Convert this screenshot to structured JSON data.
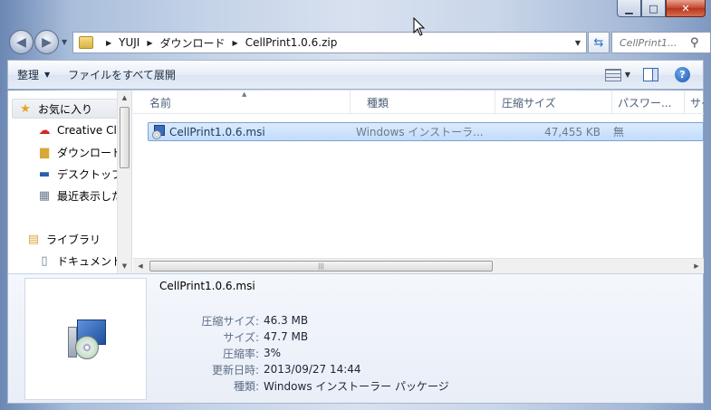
{
  "window": {
    "minimize_icon": "minimize-icon",
    "maximize_icon": "maximize-icon",
    "close_icon": "close-icon"
  },
  "address_bar": {
    "crumbs": [
      "YUJI",
      "ダウンロード",
      "CellPrint1.0.6.zip"
    ]
  },
  "search": {
    "placeholder": "CellPrint1..."
  },
  "toolbar": {
    "organize_label": "整理",
    "extract_all_label": "ファイルをすべて展開"
  },
  "nav_pane": {
    "items": [
      {
        "label": "お気に入り",
        "icon": "star-icon"
      },
      {
        "label": "Creative Clo",
        "icon": "creative-cloud-icon"
      },
      {
        "label": "ダウンロード",
        "icon": "downloads-folder-icon"
      },
      {
        "label": "デスクトップ",
        "icon": "desktop-icon"
      },
      {
        "label": "最近表示した",
        "icon": "recent-places-icon"
      },
      {
        "label": "ライブラリ",
        "icon": "library-icon"
      },
      {
        "label": "ドキュメント",
        "icon": "documents-icon"
      }
    ]
  },
  "columns": [
    "名前",
    "種類",
    "圧縮サイズ",
    "パスワー...",
    "サイ"
  ],
  "files": [
    {
      "name": "CellPrint1.0.6.msi",
      "type": "Windows インストーラ...",
      "compressed_size": "47,455 KB",
      "password": "無"
    }
  ],
  "details": {
    "filename": "CellPrint1.0.6.msi",
    "props": [
      {
        "key": "圧縮サイズ:",
        "value": "46.3 MB"
      },
      {
        "key": "サイズ:",
        "value": "47.7 MB"
      },
      {
        "key": "圧縮率:",
        "value": "3%"
      },
      {
        "key": "更新日時:",
        "value": "2013/09/27 14:44"
      },
      {
        "key": "種類:",
        "value": "Windows インストーラー パッケージ"
      }
    ]
  }
}
